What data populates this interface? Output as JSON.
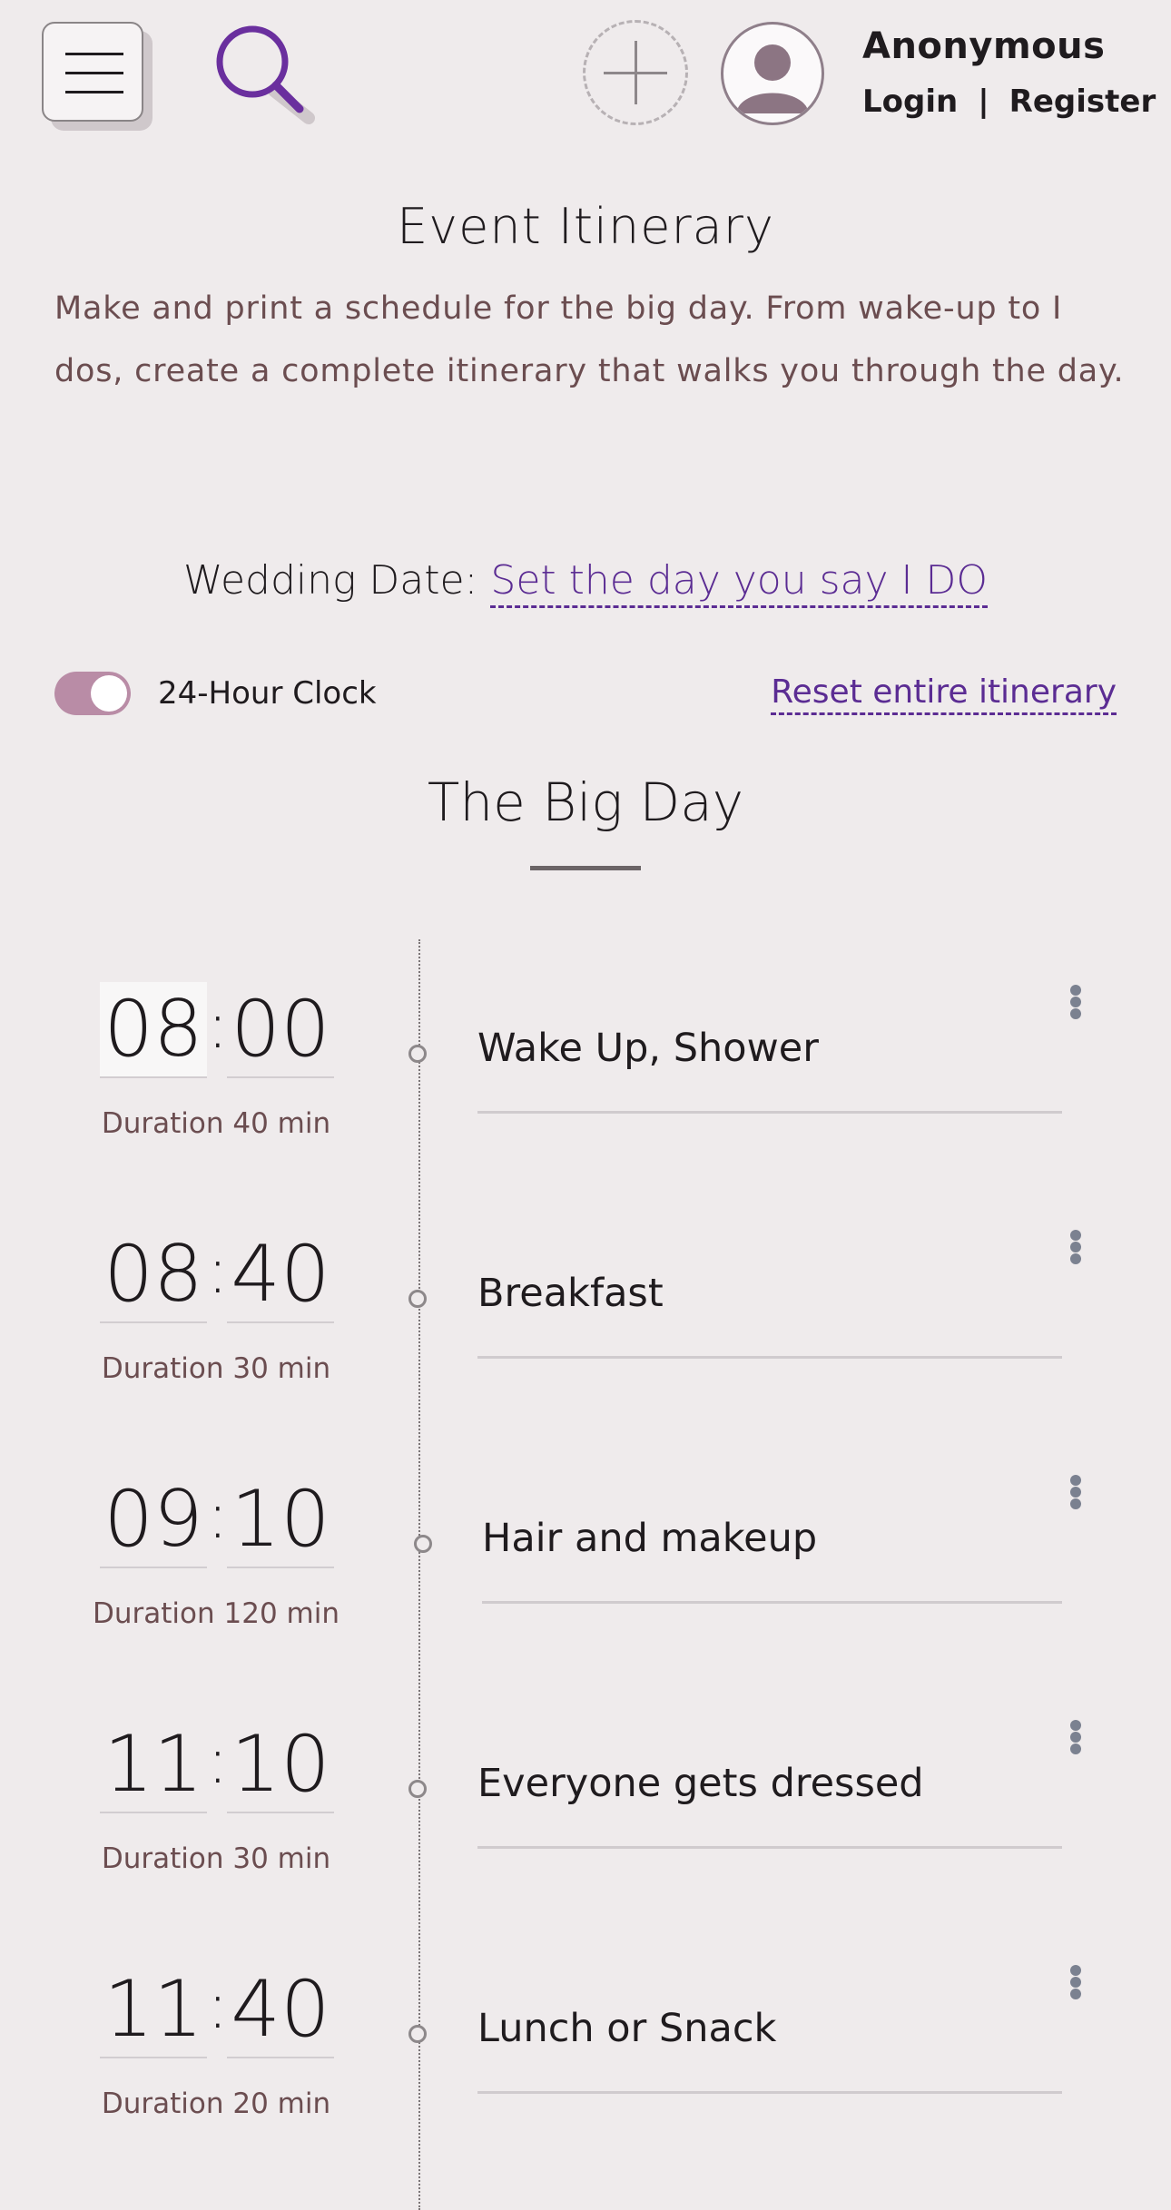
{
  "header": {
    "user_name": "Anonymous",
    "login_label": "Login",
    "separator": "|",
    "register_label": "Register"
  },
  "intro": {
    "title": "Event Itinerary",
    "description": "Make and print a schedule for the big day. From wake-up to I dos, create a complete itinerary that walks you through the day.",
    "wedding_date_label": "Wedding Date:",
    "wedding_date_link": "Set the day you say I DO"
  },
  "controls": {
    "clock_toggle_label": "24-Hour Clock",
    "clock_toggle_on": true,
    "reset_label": "Reset entire itinerary"
  },
  "section": {
    "title": "The Big Day"
  },
  "itinerary": [
    {
      "hour": "08",
      "minute": "00",
      "duration": "Duration 40 min",
      "title": "Wake Up, Shower"
    },
    {
      "hour": "08",
      "minute": "40",
      "duration": "Duration 30 min",
      "title": "Breakfast"
    },
    {
      "hour": "09",
      "minute": "10",
      "duration": "Duration 120 min",
      "title": "Hair and makeup"
    },
    {
      "hour": "11",
      "minute": "10",
      "duration": "Duration 30 min",
      "title": "Everyone gets dressed"
    },
    {
      "hour": "11",
      "minute": "40",
      "duration": "Duration 20 min",
      "title": "Lunch or Snack"
    }
  ],
  "colors": {
    "accent": "#5b2c93",
    "toggle": "#b98ca6",
    "body_text": "#6b4d50",
    "background": "#efebec"
  },
  "icons": [
    "menu-icon",
    "search-icon",
    "add-icon",
    "user-avatar-icon",
    "more-options-icon"
  ]
}
